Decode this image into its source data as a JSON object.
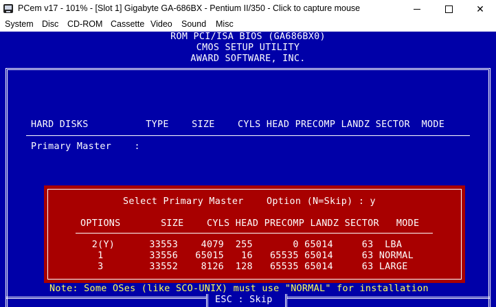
{
  "window": {
    "title": "PCem v17 - 101% - [Slot 1] Gigabyte GA-686BX - Pentium II/350 - Click to capture mouse",
    "icon": "pcem-app-icon"
  },
  "menu": [
    "System",
    "Disc",
    "CD-ROM",
    "Cassette",
    "Video",
    "Sound",
    "Misc"
  ],
  "bios": {
    "header": [
      "ROM PCI/ISA BIOS (GA686BX0)",
      "CMOS SETUP UTILITY",
      "AWARD SOFTWARE, INC."
    ],
    "columns_header": "HARD DISKS          TYPE    SIZE    CYLS HEAD PRECOMP LANDZ SECTOR  MODE",
    "primary_master_label": "Primary Master    :",
    "dialog": {
      "prompt": "Select Primary Master    Option (N=Skip) : y",
      "table_header": "OPTIONS       SIZE    CYLS HEAD PRECOMP LANDZ SECTOR   MODE",
      "rows": [
        "  2(Y)      33553    4079  255       0 65014     63  LBA",
        "   1        33556   65015   16   65535 65014     63 NORMAL",
        "   3        33552    8126  128   65535 65014     63 LARGE"
      ]
    },
    "note": "Note: Some OSes (like SCO-UNIX) must use \"NORMAL\" for installation",
    "skip": "ESC : Skip"
  }
}
